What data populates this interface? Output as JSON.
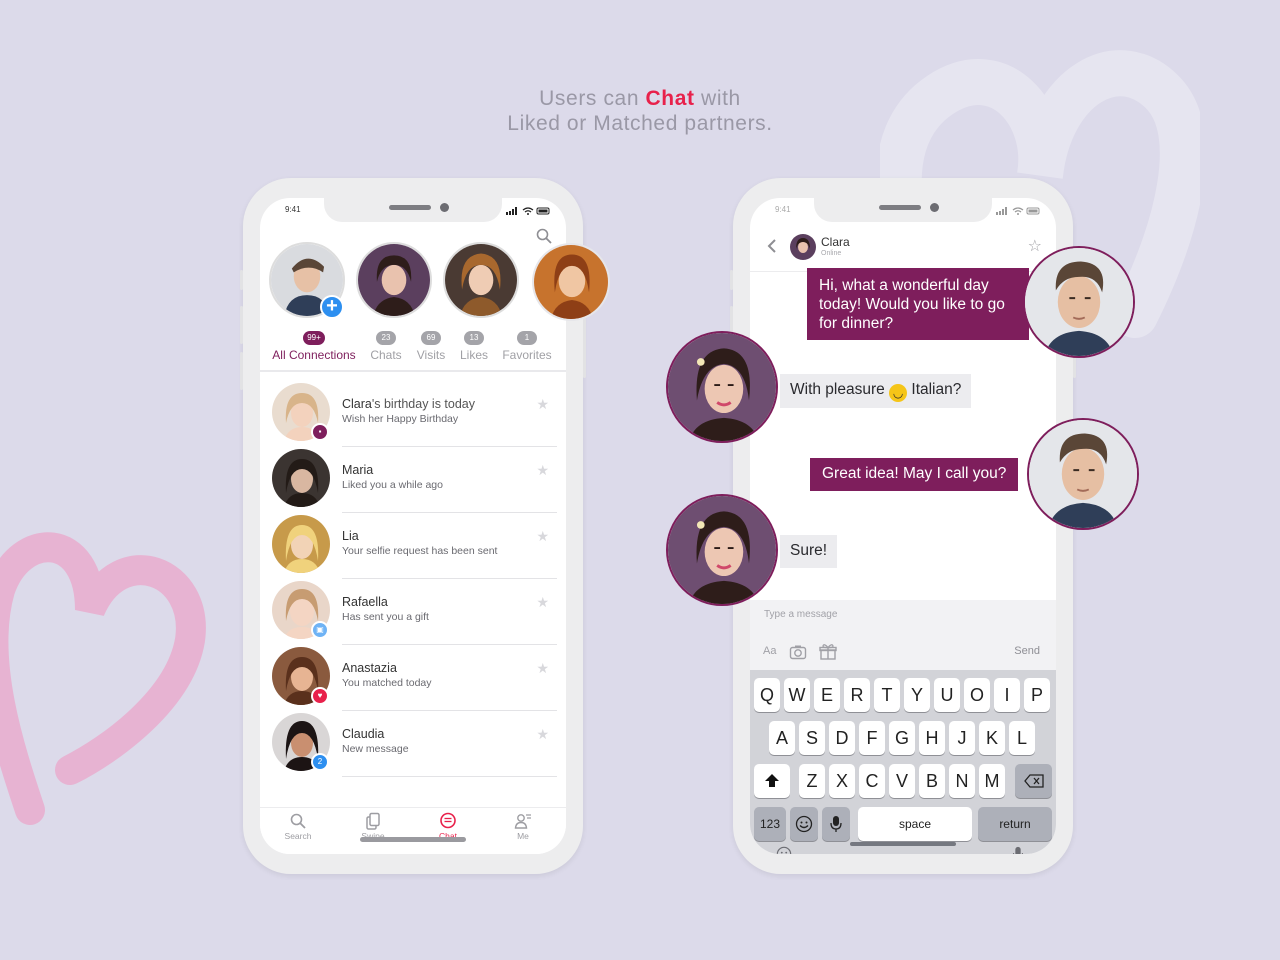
{
  "headline": {
    "line1_pre": "Users can ",
    "line1_accent": "Chat",
    "line1_post": " with",
    "line2": "Liked or Matched partners."
  },
  "colors": {
    "background": "#dcdaea",
    "brand_plum": "#7e1e5c",
    "accent_red": "#e8214b",
    "add_blue": "#2d8ff0"
  },
  "left_phone": {
    "status_time": "9:41",
    "filters": [
      {
        "count": "99+",
        "label": "All Connections",
        "active": true
      },
      {
        "count": "23",
        "label": "Chats",
        "active": false
      },
      {
        "count": "69",
        "label": "Visits",
        "active": false
      },
      {
        "count": "13",
        "label": "Likes",
        "active": false
      },
      {
        "count": "1",
        "label": "Favorites",
        "active": false
      }
    ],
    "conversations": [
      {
        "name": "Clara",
        "name_suffix": "'s birthday is today",
        "message": "Wish her Happy Birthday",
        "badge": "cake-icon",
        "badge_color": "#7e1e5c"
      },
      {
        "name": "Maria",
        "name_suffix": "",
        "message": "Liked you a while ago",
        "badge": "",
        "badge_color": ""
      },
      {
        "name": "Lia",
        "name_suffix": "",
        "message": "Your selfie request has been sent",
        "badge": "",
        "badge_color": ""
      },
      {
        "name": "Rafaella",
        "name_suffix": "",
        "message": "Has sent you a gift",
        "badge": "gift-icon",
        "badge_color": "#6fb3f5"
      },
      {
        "name": "Anastazia",
        "name_suffix": "",
        "message": "You matched today",
        "badge": "hearts-icon",
        "badge_color": "#e8214b"
      },
      {
        "name": "Claudia",
        "name_suffix": "",
        "message": "New message",
        "badge": "2",
        "badge_color": "#2d8ff0"
      }
    ],
    "tabs": [
      {
        "label": "Search",
        "icon": "search-icon",
        "active": false
      },
      {
        "label": "Swipe",
        "icon": "cards-icon",
        "active": false
      },
      {
        "label": "Chat",
        "icon": "chat-icon",
        "active": true
      },
      {
        "label": "Me",
        "icon": "profile-icon",
        "active": false
      }
    ]
  },
  "right_phone": {
    "status_time": "9:41",
    "contact_name": "Clara",
    "contact_status": "Online",
    "messages": [
      {
        "from": "me",
        "text": "Hi, what a wonderful day today! Would you like to go for dinner?"
      },
      {
        "from": "them",
        "text_pre": "With pleasure ",
        "emoji": "🙂",
        "text_post": " Italian?"
      },
      {
        "from": "me",
        "text": "Great idea! May I call you?"
      },
      {
        "from": "them",
        "text": "Sure!"
      }
    ],
    "input_placeholder": "Type a message",
    "send_label": "Send",
    "tools": [
      "Aa",
      "camera-icon",
      "gift-icon"
    ],
    "keyboard": {
      "row1": [
        "Q",
        "W",
        "E",
        "R",
        "T",
        "Y",
        "U",
        "O",
        "I",
        "P"
      ],
      "row2": [
        "A",
        "S",
        "D",
        "F",
        "G",
        "H",
        "J",
        "K",
        "L"
      ],
      "row3": [
        "Z",
        "X",
        "C",
        "V",
        "B",
        "N",
        "M"
      ],
      "numbers_key": "123",
      "space_key": "space",
      "return_key": "return"
    }
  }
}
